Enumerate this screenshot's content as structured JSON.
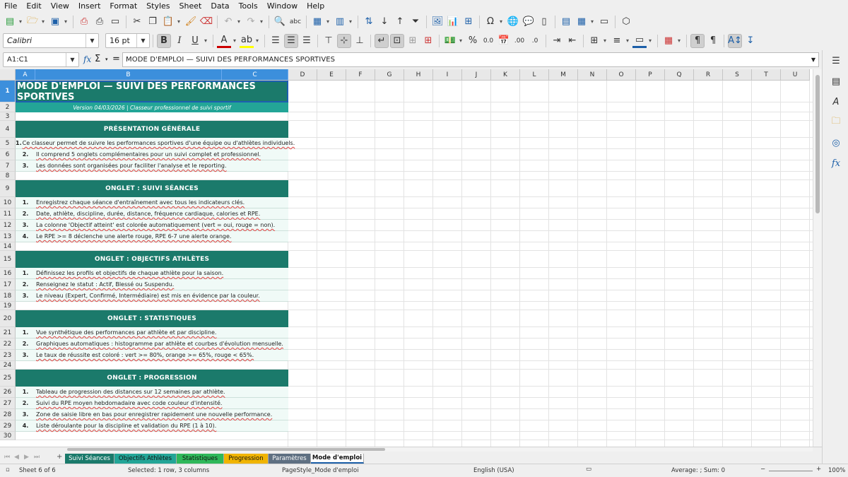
{
  "menu": [
    "File",
    "Edit",
    "View",
    "Insert",
    "Format",
    "Styles",
    "Sheet",
    "Data",
    "Tools",
    "Window",
    "Help"
  ],
  "font": {
    "name": "Calibri",
    "size": "16 pt"
  },
  "namebox": "A1:C1",
  "formula": "MODE D'EMPLOI — SUIVI DES PERFORMANCES SPORTIVES",
  "columns": [
    "A",
    "B",
    "C",
    "D",
    "E",
    "F",
    "G",
    "H",
    "I",
    "J",
    "K",
    "L",
    "M",
    "N",
    "O",
    "P",
    "Q",
    "R",
    "S",
    "T",
    "U"
  ],
  "rows": [
    "1",
    "2",
    "3",
    "4",
    "5",
    "6",
    "7",
    "8",
    "9",
    "10",
    "11",
    "12",
    "13",
    "14",
    "15",
    "16",
    "17",
    "18",
    "19",
    "20",
    "21",
    "22",
    "23",
    "24",
    "25",
    "26",
    "27",
    "28",
    "29",
    "30"
  ],
  "sheet": {
    "title": "MODE D'EMPLOI — SUIVI DES PERFORMANCES SPORTIVES",
    "subtitle": "Version 04/03/2026  |  Classeur professionnel de suivi sportif",
    "sections": [
      {
        "heading": "PRÉSENTATION GÉNÉRALE",
        "items": [
          {
            "n": "1.",
            "t": "Ce classeur permet de suivre les performances sportives d'une équipe ou d'athlètes individuels."
          },
          {
            "n": "2.",
            "t": "Il comprend 5 onglets complémentaires pour un suivi complet et professionnel."
          },
          {
            "n": "3.",
            "t": "Les données sont organisées pour faciliter l'analyse et le reporting."
          }
        ]
      },
      {
        "heading": "ONGLET : SUIVI SÉANCES",
        "items": [
          {
            "n": "1.",
            "t": "Enregistrez chaque séance d'entraînement avec tous les indicateurs clés."
          },
          {
            "n": "2.",
            "t": "Date, athlète, discipline, durée, distance, fréquence cardiaque, calories et RPE."
          },
          {
            "n": "3.",
            "t": "La colonne 'Objectif atteint' est colorée automatiquement (vert = oui, rouge = non)."
          },
          {
            "n": "4.",
            "t": "Le RPE >= 8 déclenche une alerte rouge, RPE 6-7 une alerte orange."
          }
        ]
      },
      {
        "heading": "ONGLET : OBJECTIFS ATHLÈTES",
        "items": [
          {
            "n": "1.",
            "t": "Définissez les profils et objectifs de chaque athlète pour la saison."
          },
          {
            "n": "2.",
            "t": "Renseignez le statut : Actif, Blessé ou Suspendu."
          },
          {
            "n": "3.",
            "t": "Le niveau (Expert, Confirmé, Intermédiaire) est mis en évidence par la couleur."
          }
        ]
      },
      {
        "heading": "ONGLET : STATISTIQUES",
        "items": [
          {
            "n": "1.",
            "t": "Vue synthétique des performances par athlète et par discipline."
          },
          {
            "n": "2.",
            "t": "Graphiques automatiques : histogramme par athlète et courbes d'évolution mensuelle."
          },
          {
            "n": "3.",
            "t": "Le taux de réussite est coloré : vert >= 80%, orange >= 65%, rouge < 65%."
          }
        ]
      },
      {
        "heading": "ONGLET : PROGRESSION",
        "items": [
          {
            "n": "1.",
            "t": "Tableau de progression des distances sur 12 semaines par athlète."
          },
          {
            "n": "2.",
            "t": "Suivi du RPE moyen hebdomadaire avec code couleur d'intensité."
          },
          {
            "n": "3.",
            "t": "Zone de saisie libre en bas pour enregistrer rapidement une nouvelle performance."
          },
          {
            "n": "4.",
            "t": "Liste déroulante pour la discipline et validation du RPE (1 à 10)."
          }
        ]
      }
    ]
  },
  "tabs": [
    {
      "label": "Suivi Séances",
      "color": "#1b7a6b",
      "text": "#ffffff"
    },
    {
      "label": "Objectifs Athlètes",
      "color": "#23a597",
      "text": "#111111"
    },
    {
      "label": "Statistiques",
      "color": "#2fb85a",
      "text": "#111111"
    },
    {
      "label": "Progression",
      "color": "#f0b400",
      "text": "#111111"
    },
    {
      "label": "Paramètres",
      "color": "#5f7082",
      "text": "#ffffff"
    },
    {
      "label": "Mode d'emploi",
      "color": "#ffffff",
      "text": "#111111"
    }
  ],
  "status": {
    "sheet": "Sheet 6 of 6",
    "selection": "Selected: 1 row, 3 columns",
    "pagestyle": "PageStyle_Mode d'emploi",
    "lang": "English (USA)",
    "sum": "Average: ; Sum: 0",
    "zoom": "100%"
  },
  "colors": {
    "banner": "#1b7a6b",
    "subtitle": "#23a597",
    "item_bg": "#f0faf7"
  }
}
